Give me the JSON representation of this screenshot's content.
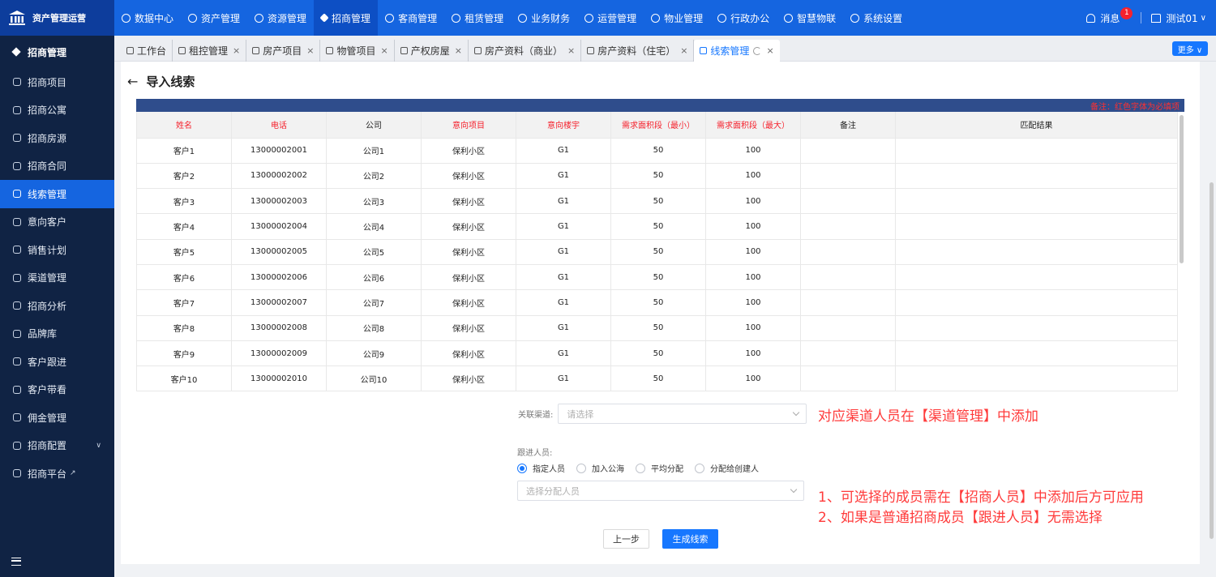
{
  "app": {
    "title": "资产管理运营"
  },
  "topnav": [
    {
      "label": "数据中心",
      "active": false
    },
    {
      "label": "资产管理",
      "active": false
    },
    {
      "label": "资源管理",
      "active": false
    },
    {
      "label": "招商管理",
      "active": true
    },
    {
      "label": "客商管理",
      "active": false
    },
    {
      "label": "租赁管理",
      "active": false
    },
    {
      "label": "业务财务",
      "active": false
    },
    {
      "label": "运营管理",
      "active": false
    },
    {
      "label": "物业管理",
      "active": false
    },
    {
      "label": "行政办公",
      "active": false
    },
    {
      "label": "智慧物联",
      "active": false
    },
    {
      "label": "系统设置",
      "active": false
    }
  ],
  "header": {
    "messages_label": "消息",
    "messages_count": "1",
    "user_name": "测试01",
    "user_caret": "∨"
  },
  "sidebar": {
    "title": "招商管理",
    "items": [
      {
        "label": "招商项目",
        "active": false
      },
      {
        "label": "招商公寓",
        "active": false
      },
      {
        "label": "招商房源",
        "active": false
      },
      {
        "label": "招商合同",
        "active": false
      },
      {
        "label": "线索管理",
        "active": true
      },
      {
        "label": "意向客户",
        "active": false
      },
      {
        "label": "销售计划",
        "active": false
      },
      {
        "label": "渠道管理",
        "active": false
      },
      {
        "label": "招商分析",
        "active": false
      },
      {
        "label": "品牌库",
        "active": false
      },
      {
        "label": "客户跟进",
        "active": false
      },
      {
        "label": "客户带看",
        "active": false
      },
      {
        "label": "佣金管理",
        "active": false
      },
      {
        "label": "招商配置",
        "active": false,
        "has_children": true
      },
      {
        "label": "招商平台",
        "active": false,
        "external": true
      }
    ]
  },
  "tabs": [
    {
      "label": "工作台",
      "closable": false,
      "active": false
    },
    {
      "label": "租控管理",
      "closable": true,
      "active": false
    },
    {
      "label": "房产项目",
      "closable": true,
      "active": false
    },
    {
      "label": "物管项目",
      "closable": true,
      "active": false
    },
    {
      "label": "产权房屋",
      "closable": true,
      "active": false
    },
    {
      "label": "房产资料（商业）",
      "closable": true,
      "active": false
    },
    {
      "label": "房产资料（住宅）",
      "closable": true,
      "active": false
    },
    {
      "label": "线索管理",
      "closable": true,
      "active": true
    }
  ],
  "tabs_more_label": "更多 ∨",
  "page": {
    "title": "导入线索",
    "back_icon": "←",
    "table_note": "备注：红色字体为必填项"
  },
  "table": {
    "columns": [
      {
        "label": "姓名",
        "required": true
      },
      {
        "label": "电话",
        "required": true
      },
      {
        "label": "公司",
        "required": false
      },
      {
        "label": "意向项目",
        "required": true
      },
      {
        "label": "意向楼宇",
        "required": true
      },
      {
        "label": "需求面积段（最小）",
        "required": true
      },
      {
        "label": "需求面积段（最大）",
        "required": true
      },
      {
        "label": "备注",
        "required": false
      },
      {
        "label": "匹配结果",
        "required": false
      }
    ],
    "rows": [
      [
        "客户1",
        "13000002001",
        "公司1",
        "保利小区",
        "G1",
        "50",
        "100",
        "",
        ""
      ],
      [
        "客户2",
        "13000002002",
        "公司2",
        "保利小区",
        "G1",
        "50",
        "100",
        "",
        ""
      ],
      [
        "客户3",
        "13000002003",
        "公司3",
        "保利小区",
        "G1",
        "50",
        "100",
        "",
        ""
      ],
      [
        "客户4",
        "13000002004",
        "公司4",
        "保利小区",
        "G1",
        "50",
        "100",
        "",
        ""
      ],
      [
        "客户5",
        "13000002005",
        "公司5",
        "保利小区",
        "G1",
        "50",
        "100",
        "",
        ""
      ],
      [
        "客户6",
        "13000002006",
        "公司6",
        "保利小区",
        "G1",
        "50",
        "100",
        "",
        ""
      ],
      [
        "客户7",
        "13000002007",
        "公司7",
        "保利小区",
        "G1",
        "50",
        "100",
        "",
        ""
      ],
      [
        "客户8",
        "13000002008",
        "公司8",
        "保利小区",
        "G1",
        "50",
        "100",
        "",
        ""
      ],
      [
        "客户9",
        "13000002009",
        "公司9",
        "保利小区",
        "G1",
        "50",
        "100",
        "",
        ""
      ],
      [
        "客户10",
        "13000002010",
        "公司10",
        "保利小区",
        "G1",
        "50",
        "100",
        "",
        ""
      ]
    ]
  },
  "form": {
    "channel_label": "关联渠道:",
    "channel_placeholder": "请选择",
    "follow_label": "跟进人员:",
    "radio_options": [
      {
        "label": "指定人员",
        "checked": true
      },
      {
        "label": "加入公海",
        "checked": false
      },
      {
        "label": "平均分配",
        "checked": false
      },
      {
        "label": "分配给创建人",
        "checked": false
      }
    ],
    "assignee_placeholder": "选择分配人员"
  },
  "annotations": {
    "channel_note": "对应渠道人员在【渠道管理】中添加",
    "assignee_note_1": "1、可选择的成员需在【招商人员】中添加后方可应用",
    "assignee_note_2": "2、如果是普通招商成员【跟进人员】无需选择"
  },
  "buttons": {
    "prev": "上一步",
    "generate": "生成线索"
  },
  "colors": {
    "primary": "#1677ff",
    "topbar": "#1565e0",
    "sidebar": "#102344",
    "required": "#f5222d",
    "annotation": "#ff3b3b"
  }
}
